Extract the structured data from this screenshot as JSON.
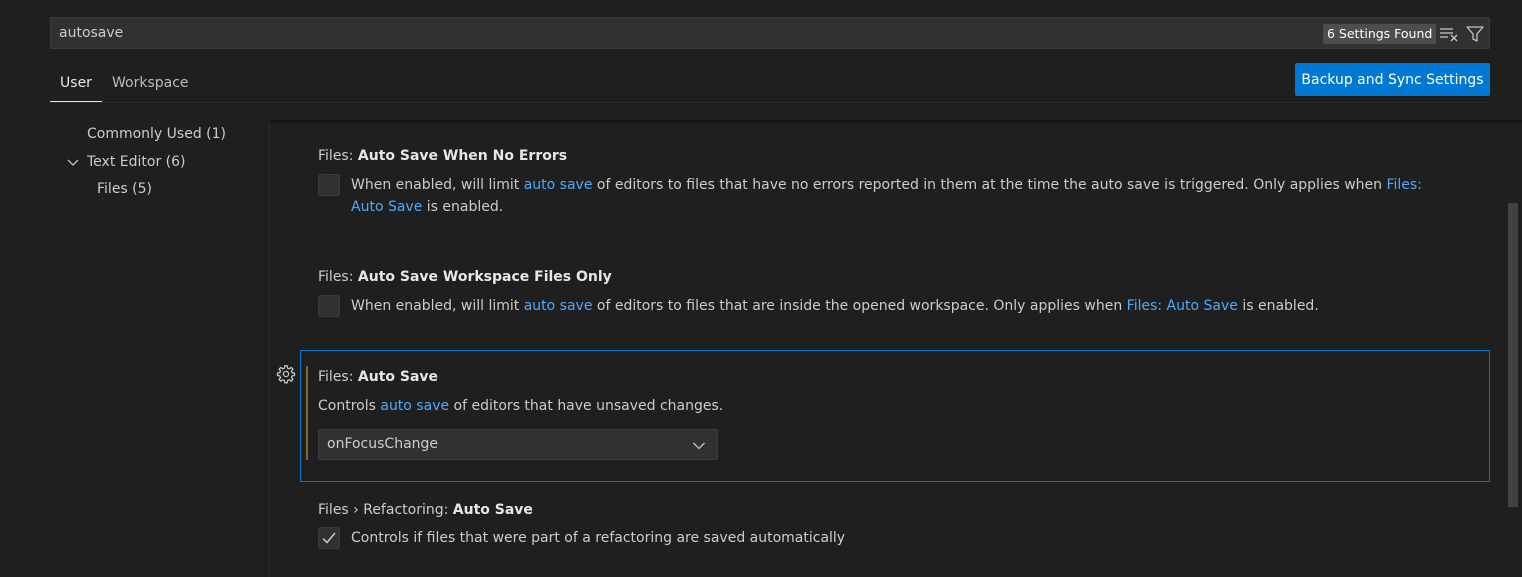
{
  "search": {
    "value": "autosave",
    "count_label": "6 Settings Found",
    "clear_icon": "clear-filter-icon",
    "filter_icon": "funnel-filter-icon"
  },
  "tabs": [
    {
      "label": "User",
      "active": true
    },
    {
      "label": "Workspace",
      "active": false
    }
  ],
  "sync_button": {
    "label": "Backup and Sync Settings"
  },
  "toc": {
    "items": [
      {
        "label": "Commonly Used (1)"
      },
      {
        "label": "Text Editor (6)",
        "expanded": true
      },
      {
        "label": "Files (5)"
      }
    ]
  },
  "settings": [
    {
      "category": "Files: ",
      "name": "Auto Save When No Errors",
      "type": "checkbox",
      "checked": false,
      "desc_1": "When enabled, will limit ",
      "link_1": "auto save",
      "desc_2": " of editors to files that have no errors reported in them at the time the auto save is triggered. Only applies when ",
      "link_2": "Files: Auto Save",
      "desc_3": " is enabled."
    },
    {
      "category": "Files: ",
      "name": "Auto Save Workspace Files Only",
      "type": "checkbox",
      "checked": false,
      "desc_1": "When enabled, will limit ",
      "link_1": "auto save",
      "desc_2": " of editors to files that are inside the opened workspace. Only applies when ",
      "link_2": "Files: Auto Save",
      "desc_3": " is enabled."
    },
    {
      "category": "Files: ",
      "name": "Auto Save",
      "type": "select",
      "desc_1": "Controls ",
      "link_1": "auto save",
      "desc_2": " of editors that have unsaved changes.",
      "selected": "onFocusChange",
      "focused": true,
      "modified": true
    },
    {
      "category": "Files › Refactoring: ",
      "name": "Auto Save",
      "type": "checkbox",
      "checked": true,
      "desc_1": "Controls if files that were part of a refactoring are saved automatically"
    }
  ],
  "colors": {
    "background": "#1f1f1f",
    "accent": "#0078d4",
    "link": "#4daafc",
    "modified_indicator": "#7f6a2a"
  }
}
